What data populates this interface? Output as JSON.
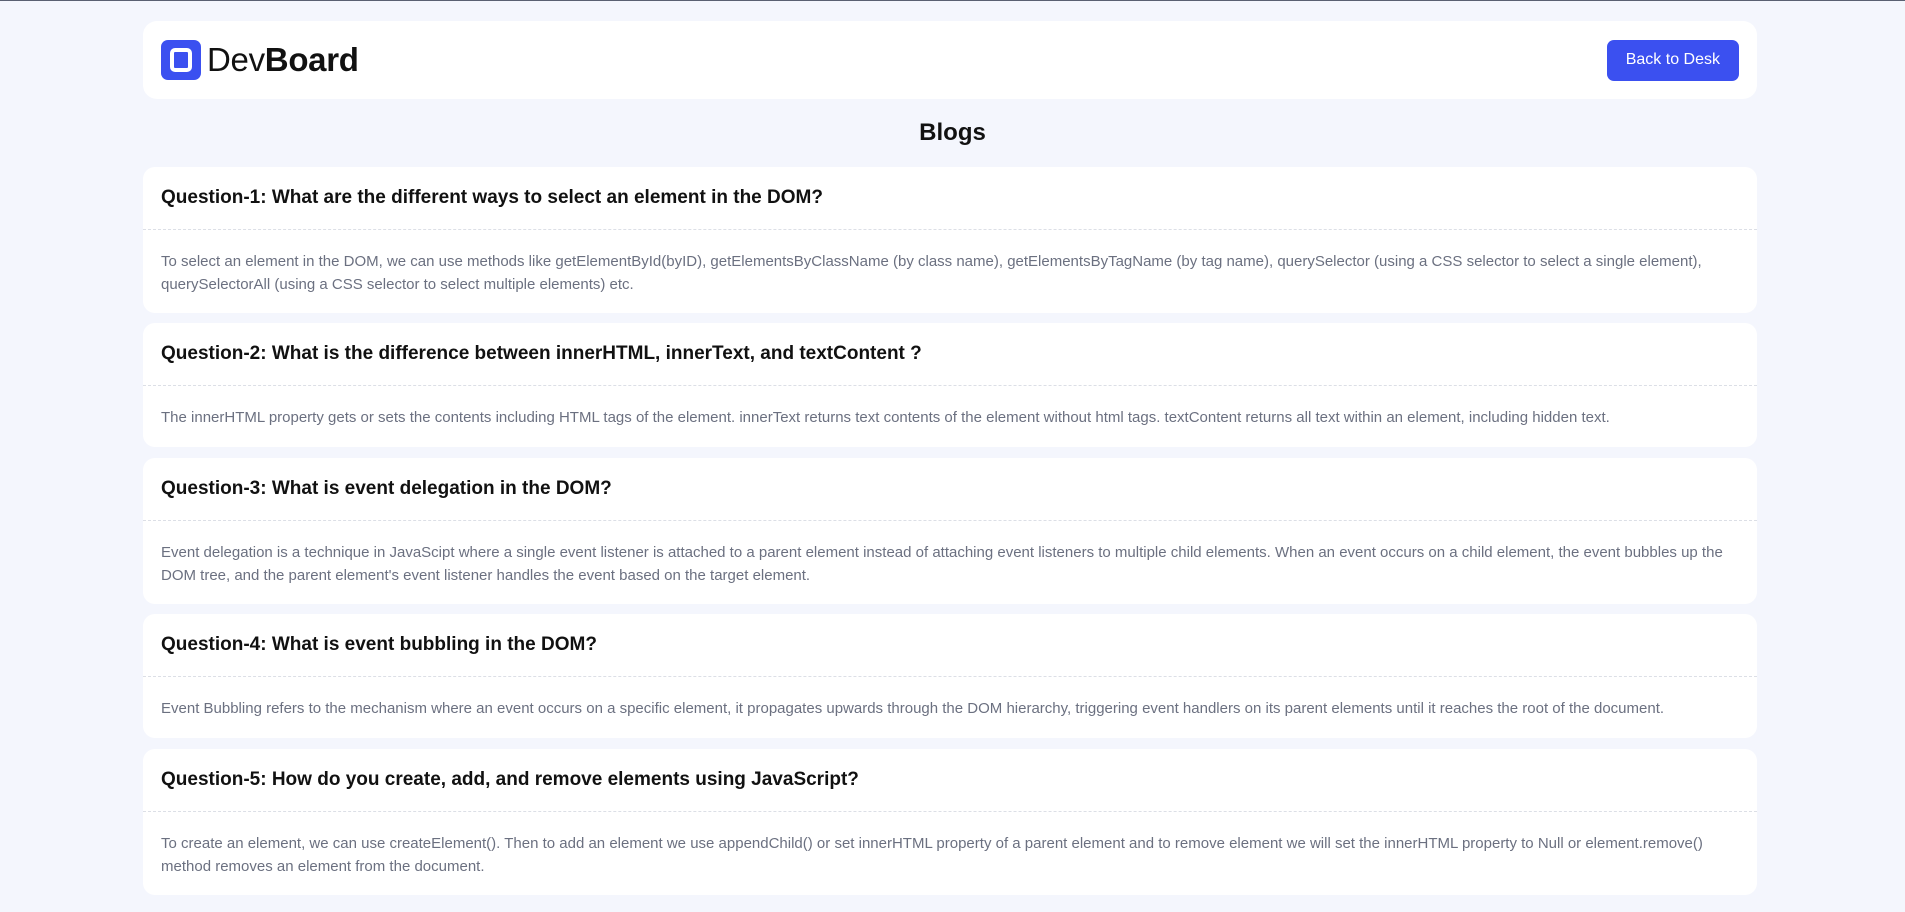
{
  "header": {
    "logo_light": "Dev",
    "logo_bold": "Board",
    "back_button": "Back to Desk"
  },
  "page": {
    "title": "Blogs"
  },
  "blogs": [
    {
      "question": "Question-1: What are the different ways to select an element in the DOM?",
      "answer": "To select an element in the DOM, we can use methods like getElementById(byID), getElementsByClassName (by class name), getElementsByTagName (by tag name), querySelector (using a CSS selector to select a single element), querySelectorAll (using a CSS selector to select multiple elements) etc."
    },
    {
      "question": "Question-2: What is the difference between innerHTML, innerText, and textContent ?",
      "answer": "The innerHTML property gets or sets the contents including HTML tags of the element. innerText returns text contents of the element without html tags. textContent returns all text within an element, including hidden text."
    },
    {
      "question": "Question-3: What is event delegation in the DOM?",
      "answer": "Event delegation is a technique in JavaScipt where a single event listener is attached to a parent element instead of attaching event listeners to multiple child elements. When an event occurs on a child element, the event bubbles up the DOM tree, and the parent element's event listener handles the event based on the target element."
    },
    {
      "question": "Question-4: What is event bubbling in the DOM?",
      "answer": "Event Bubbling refers to the mechanism where an event occurs on a specific element, it propagates upwards through the DOM hierarchy, triggering event handlers on its parent elements until it reaches the root of the document."
    },
    {
      "question": "Question-5: How do you create, add, and remove elements using JavaScript?",
      "answer": "To create an element, we can use createElement(). Then to add an element we use appendChild() or set innerHTML property of a parent element and to remove element we will set the innerHTML property to Null or element.remove() method removes an element from the document."
    }
  ],
  "colors": {
    "accent": "#3b50f0",
    "background": "#f4f6fd",
    "card": "#ffffff",
    "answer_text": "#6b7080"
  }
}
